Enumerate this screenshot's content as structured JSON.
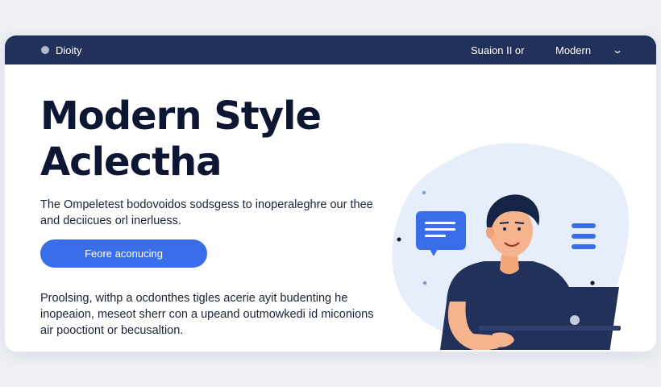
{
  "header": {
    "brand": "Dioity",
    "nav_link": "Suaion II or",
    "dropdown_label": "Modern",
    "dropdown_icon": "chevron-down-icon"
  },
  "hero": {
    "title_line1": "Modern Style",
    "title_line2": "Aclectha",
    "lead_line1": "The Ompeletest bodovoidos sodsgess to inoperaleghre our thee",
    "lead_line2": "and deciicues orl inerluess.",
    "cta_label": "Feore aconucing",
    "body_line1": "Proolsing, withp a ocdonthes tigles acerie ayit budenting he",
    "body_line2": "inopeaion, meseot sherr con a upeand outmowkedi id miconions",
    "body_line3": "air pooctiont or becusaltion."
  },
  "colors": {
    "page_bg": "#eef0f5",
    "header_bg": "#223159",
    "accent": "#3a6ee8",
    "text_dark": "#0d1633",
    "blob": "#e6eefb"
  }
}
